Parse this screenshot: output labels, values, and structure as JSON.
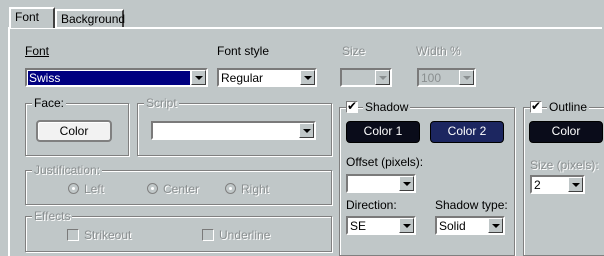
{
  "tabs": [
    "Font",
    "Background"
  ],
  "font": {
    "label": "Font",
    "value": "Swiss",
    "style_label": "Font style",
    "style_value": "Regular",
    "size_label": "Size",
    "width_label": "Width %",
    "width_value": "100"
  },
  "face": {
    "title": "Face:",
    "color_button": "Color"
  },
  "script": {
    "title": "Script"
  },
  "justification": {
    "title": "Justification:",
    "options": [
      "Left",
      "Center",
      "Right"
    ]
  },
  "effects": {
    "title": "Effects",
    "strikeout": "Strikeout",
    "underline": "Underline"
  },
  "shadow": {
    "title": "Shadow",
    "checked": true,
    "color1_button": "Color 1",
    "color2_button": "Color 2",
    "offset_label": "Offset (pixels):",
    "offset_value": "",
    "direction_label": "Direction:",
    "direction_value": "SE",
    "type_label": "Shadow type:",
    "type_value": "Solid"
  },
  "outline": {
    "title": "Outline",
    "checked": true,
    "color_button": "Color",
    "size_label": "Size (pixels):",
    "size_value": "2"
  },
  "colors": {
    "face_button": "#f2f2f2",
    "shadow_color1": "#0a0c1a",
    "shadow_color2": "#1c2660",
    "outline_color": "#0a0c1a",
    "selection": "#000080"
  }
}
